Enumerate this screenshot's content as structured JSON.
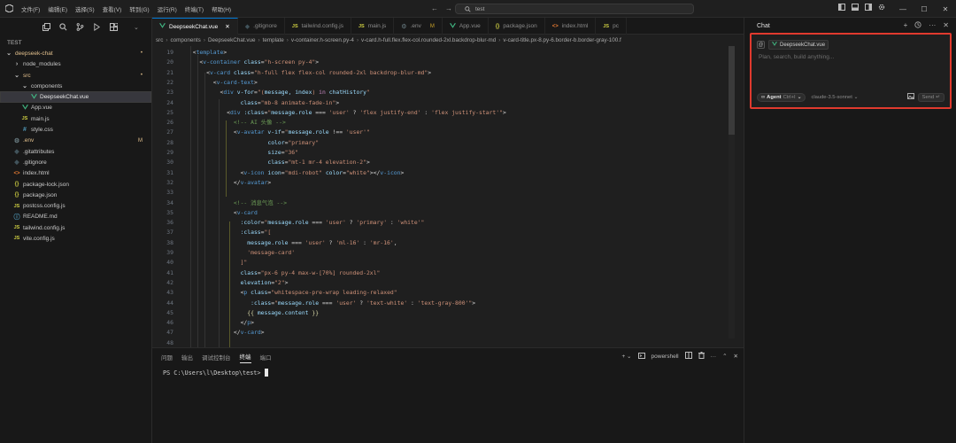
{
  "titlebar": {
    "menu": [
      "文件(F)",
      "编辑(E)",
      "选择(S)",
      "查看(V)",
      "转到(G)",
      "运行(R)",
      "终端(T)",
      "帮助(H)"
    ],
    "search_text": "test"
  },
  "sidebar": {
    "root": "TEST",
    "items": [
      {
        "label": "deepseek-chat",
        "badge": "•",
        "icon": "chevron-down",
        "indent": 0,
        "color": "#e2c08d"
      },
      {
        "label": "node_modules",
        "badge": "",
        "icon": "chevron-right",
        "indent": 1,
        "color": "#c8c8c8"
      },
      {
        "label": "src",
        "badge": "•",
        "icon": "chevron-down",
        "indent": 1,
        "color": "#e2c08d"
      },
      {
        "label": "components",
        "badge": "",
        "icon": "chevron-down",
        "indent": 2,
        "color": "#c8c8c8"
      },
      {
        "label": "DeepseekChat.vue",
        "badge": "",
        "icon": "vue",
        "indent": 3,
        "color": "#e7e7e7",
        "active": true
      },
      {
        "label": "App.vue",
        "badge": "",
        "icon": "vue",
        "indent": 2,
        "color": "#c8c8c8"
      },
      {
        "label": "main.js",
        "badge": "",
        "icon": "js",
        "indent": 2,
        "color": "#c8c8c8"
      },
      {
        "label": "style.css",
        "badge": "",
        "icon": "css",
        "indent": 2,
        "color": "#c8c8c8"
      },
      {
        "label": ".env",
        "badge": "M",
        "icon": "gear",
        "indent": 1,
        "color": "#e2c08d"
      },
      {
        "label": ".gitattributes",
        "badge": "",
        "icon": "git",
        "indent": 1,
        "color": "#c8c8c8"
      },
      {
        "label": ".gitignore",
        "badge": "",
        "icon": "git",
        "indent": 1,
        "color": "#c8c8c8"
      },
      {
        "label": "index.html",
        "badge": "",
        "icon": "html",
        "indent": 1,
        "color": "#c8c8c8"
      },
      {
        "label": "package-lock.json",
        "badge": "",
        "icon": "json",
        "indent": 1,
        "color": "#c8c8c8"
      },
      {
        "label": "package.json",
        "badge": "",
        "icon": "json",
        "indent": 1,
        "color": "#c8c8c8"
      },
      {
        "label": "postcss.config.js",
        "badge": "",
        "icon": "js",
        "indent": 1,
        "color": "#c8c8c8"
      },
      {
        "label": "README.md",
        "badge": "",
        "icon": "info",
        "indent": 1,
        "color": "#c8c8c8"
      },
      {
        "label": "tailwind.config.js",
        "badge": "",
        "icon": "js",
        "indent": 1,
        "color": "#c8c8c8"
      },
      {
        "label": "vite.config.js",
        "badge": "",
        "icon": "js",
        "indent": 1,
        "color": "#c8c8c8"
      }
    ]
  },
  "tabs": [
    {
      "label": "DeepseekChat.vue",
      "icon": "vue",
      "active": true,
      "modified": ""
    },
    {
      "label": ".gitignore",
      "icon": "git",
      "active": false,
      "modified": ""
    },
    {
      "label": "tailwind.config.js",
      "icon": "js",
      "active": false,
      "modified": ""
    },
    {
      "label": "main.js",
      "icon": "js",
      "active": false,
      "modified": ""
    },
    {
      "label": ".env",
      "icon": "gear",
      "active": false,
      "modified": "M"
    },
    {
      "label": "App.vue",
      "icon": "vue",
      "active": false,
      "modified": ""
    },
    {
      "label": "package.json",
      "icon": "json",
      "active": false,
      "modified": ""
    },
    {
      "label": "index.html",
      "icon": "html",
      "active": false,
      "modified": ""
    },
    {
      "label": "pc",
      "icon": "js",
      "active": false,
      "modified": ""
    }
  ],
  "breadcrumb": [
    "src",
    "components",
    "DeepseekChat.vue",
    "template",
    "v-container.h-screen.py-4",
    "v-card.h-full.flex.flex-col.rounded-2xl.backdrop-blur-md",
    "v-card-title.px-8.py-6.border-b.border-gray-100.f"
  ],
  "code_lines": [
    {
      "n": "19",
      "t": [
        [
          "",
          "  "
        ],
        [
          "t-br",
          "<"
        ],
        [
          "t-tag",
          "template"
        ],
        [
          "t-br",
          ">"
        ]
      ]
    },
    {
      "n": "20",
      "t": [
        [
          "",
          "    "
        ],
        [
          "t-br",
          "<"
        ],
        [
          "t-tag",
          "v-container"
        ],
        [
          "",
          " "
        ],
        [
          "t-attr",
          "class"
        ],
        [
          "",
          "="
        ],
        [
          "t-str",
          "\"h-screen py-4\""
        ],
        [
          "t-br",
          ">"
        ]
      ]
    },
    {
      "n": "21",
      "t": [
        [
          "",
          "      "
        ],
        [
          "t-br",
          "<"
        ],
        [
          "t-tag",
          "v-card"
        ],
        [
          "",
          " "
        ],
        [
          "t-attr",
          "class"
        ],
        [
          "",
          "="
        ],
        [
          "t-str",
          "\"h-full flex flex-col rounded-2xl backdrop-blur-md\""
        ],
        [
          "t-br",
          ">"
        ]
      ]
    },
    {
      "n": "22",
      "t": [
        [
          "",
          "        "
        ],
        [
          "t-br",
          "<"
        ],
        [
          "t-tag",
          "v-card-text"
        ],
        [
          "t-br",
          ">"
        ]
      ]
    },
    {
      "n": "23",
      "t": [
        [
          "",
          "          "
        ],
        [
          "t-br",
          "<"
        ],
        [
          "t-tag",
          "div"
        ],
        [
          "",
          " "
        ],
        [
          "t-attr",
          "v-for"
        ],
        [
          "",
          "="
        ],
        [
          "t-str",
          "\"("
        ],
        [
          "t-var",
          "message, index"
        ],
        [
          "t-str",
          ") "
        ],
        [
          "t-kw",
          "in"
        ],
        [
          "t-var",
          " chatHistory"
        ],
        [
          "t-str",
          "\""
        ]
      ]
    },
    {
      "n": "24",
      "t": [
        [
          "",
          "                "
        ],
        [
          "t-attr",
          "class"
        ],
        [
          "",
          "="
        ],
        [
          "t-str",
          "\"mb-8 animate-fade-in\""
        ],
        [
          "t-br",
          ">"
        ]
      ]
    },
    {
      "n": "25",
      "t": [
        [
          "",
          "            "
        ],
        [
          "t-br",
          "<"
        ],
        [
          "t-tag",
          "div"
        ],
        [
          "",
          " "
        ],
        [
          "t-attr",
          ":class"
        ],
        [
          "",
          "="
        ],
        [
          "t-str",
          "\""
        ],
        [
          "t-var",
          "message.role"
        ],
        [
          "",
          " === "
        ],
        [
          "t-str",
          "'user'"
        ],
        [
          "",
          " ? "
        ],
        [
          "t-str",
          "'flex justify-end'"
        ],
        [
          "",
          " : "
        ],
        [
          "t-str",
          "'flex justify-start'"
        ],
        [
          "t-str",
          "\""
        ],
        [
          "t-br",
          ">"
        ]
      ]
    },
    {
      "n": "26",
      "t": [
        [
          "",
          "              "
        ],
        [
          "t-com",
          "<!-- AI 头像 -->"
        ]
      ]
    },
    {
      "n": "27",
      "t": [
        [
          "",
          "              "
        ],
        [
          "t-br",
          "<"
        ],
        [
          "t-tag",
          "v-avatar"
        ],
        [
          "",
          " "
        ],
        [
          "t-attr",
          "v-if"
        ],
        [
          "",
          "="
        ],
        [
          "t-str",
          "\""
        ],
        [
          "t-var",
          "message.role"
        ],
        [
          "",
          " !== "
        ],
        [
          "t-str",
          "'user'\""
        ]
      ]
    },
    {
      "n": "28",
      "t": [
        [
          "",
          "                        "
        ],
        [
          "t-attr",
          "color"
        ],
        [
          "",
          "="
        ],
        [
          "t-str",
          "\"primary\""
        ]
      ]
    },
    {
      "n": "29",
      "t": [
        [
          "",
          "                        "
        ],
        [
          "t-attr",
          "size"
        ],
        [
          "",
          "="
        ],
        [
          "t-str",
          "\"36\""
        ]
      ]
    },
    {
      "n": "30",
      "t": [
        [
          "",
          "                        "
        ],
        [
          "t-attr",
          "class"
        ],
        [
          "",
          "="
        ],
        [
          "t-str",
          "\"mt-1 mr-4 elevation-2\""
        ],
        [
          "t-br",
          ">"
        ]
      ]
    },
    {
      "n": "31",
      "t": [
        [
          "",
          "                "
        ],
        [
          "t-br",
          "<"
        ],
        [
          "t-tag",
          "v-icon"
        ],
        [
          "",
          " "
        ],
        [
          "t-attr",
          "icon"
        ],
        [
          "",
          "="
        ],
        [
          "t-str",
          "\"mdi-robot\""
        ],
        [
          "",
          " "
        ],
        [
          "t-attr",
          "color"
        ],
        [
          "",
          "="
        ],
        [
          "t-str",
          "\"white\""
        ],
        [
          "t-br",
          "></"
        ],
        [
          "t-tag",
          "v-icon"
        ],
        [
          "t-br",
          ">"
        ]
      ]
    },
    {
      "n": "32",
      "t": [
        [
          "",
          "              "
        ],
        [
          "t-br",
          "</"
        ],
        [
          "t-tag",
          "v-avatar"
        ],
        [
          "t-br",
          ">"
        ]
      ]
    },
    {
      "n": "33",
      "t": [
        [
          "",
          ""
        ]
      ]
    },
    {
      "n": "34",
      "t": [
        [
          "",
          "              "
        ],
        [
          "t-com",
          "<!-- 消息气泡 -->"
        ]
      ]
    },
    {
      "n": "35",
      "t": [
        [
          "",
          "              "
        ],
        [
          "t-br",
          "<"
        ],
        [
          "t-tag",
          "v-card"
        ]
      ]
    },
    {
      "n": "36",
      "t": [
        [
          "",
          "                "
        ],
        [
          "t-attr",
          ":color"
        ],
        [
          "",
          "="
        ],
        [
          "t-str",
          "\""
        ],
        [
          "t-var",
          "message.role"
        ],
        [
          "",
          " === "
        ],
        [
          "t-str",
          "'user'"
        ],
        [
          "",
          " ? "
        ],
        [
          "t-str",
          "'primary'"
        ],
        [
          "",
          " : "
        ],
        [
          "t-str",
          "'white'\""
        ]
      ]
    },
    {
      "n": "37",
      "t": [
        [
          "",
          "                "
        ],
        [
          "t-attr",
          ":class"
        ],
        [
          "",
          "="
        ],
        [
          "t-str",
          "\"["
        ]
      ]
    },
    {
      "n": "38",
      "t": [
        [
          "",
          "                  "
        ],
        [
          "t-var",
          "message.role"
        ],
        [
          "",
          " === "
        ],
        [
          "t-str",
          "'user'"
        ],
        [
          "",
          " ? "
        ],
        [
          "t-str",
          "'ml-16'"
        ],
        [
          "",
          " : "
        ],
        [
          "t-str",
          "'mr-16'"
        ],
        [
          "",
          ","
        ]
      ]
    },
    {
      "n": "39",
      "t": [
        [
          "",
          "                  "
        ],
        [
          "t-str",
          "'message-card'"
        ]
      ]
    },
    {
      "n": "40",
      "t": [
        [
          "",
          "                "
        ],
        [
          "t-str",
          "]\""
        ]
      ]
    },
    {
      "n": "41",
      "t": [
        [
          "",
          "                "
        ],
        [
          "t-attr",
          "class"
        ],
        [
          "",
          "="
        ],
        [
          "t-str",
          "\"px-6 py-4 max-w-[70%] rounded-2xl\""
        ]
      ]
    },
    {
      "n": "42",
      "t": [
        [
          "",
          "                "
        ],
        [
          "t-attr",
          "elevation"
        ],
        [
          "",
          "="
        ],
        [
          "t-str",
          "\"2\""
        ],
        [
          "t-br",
          ">"
        ]
      ]
    },
    {
      "n": "43",
      "t": [
        [
          "",
          "                "
        ],
        [
          "t-br",
          "<"
        ],
        [
          "t-tag",
          "p"
        ],
        [
          "",
          " "
        ],
        [
          "t-attr",
          "class"
        ],
        [
          "",
          "="
        ],
        [
          "t-str",
          "\"whitespace-pre-wrap leading-relaxed\""
        ]
      ]
    },
    {
      "n": "44",
      "t": [
        [
          "",
          "                   "
        ],
        [
          "t-attr",
          ":class"
        ],
        [
          "",
          "="
        ],
        [
          "t-str",
          "\""
        ],
        [
          "t-var",
          "message.role"
        ],
        [
          "",
          " === "
        ],
        [
          "t-str",
          "'user'"
        ],
        [
          "",
          " ? "
        ],
        [
          "t-str",
          "'text-white'"
        ],
        [
          "",
          " : "
        ],
        [
          "t-str",
          "'text-gray-800'\""
        ],
        [
          "t-br",
          ">"
        ]
      ]
    },
    {
      "n": "45",
      "t": [
        [
          "",
          "                  "
        ],
        [
          "t-y",
          "{{ "
        ],
        [
          "t-var",
          "message.content"
        ],
        [
          "t-y",
          " }}"
        ]
      ]
    },
    {
      "n": "46",
      "t": [
        [
          "",
          "                "
        ],
        [
          "t-br",
          "</"
        ],
        [
          "t-tag",
          "p"
        ],
        [
          "t-br",
          ">"
        ]
      ]
    },
    {
      "n": "47",
      "t": [
        [
          "",
          "              "
        ],
        [
          "t-br",
          "</"
        ],
        [
          "t-tag",
          "v-card"
        ],
        [
          "t-br",
          ">"
        ]
      ]
    },
    {
      "n": "48",
      "t": [
        [
          "",
          ""
        ]
      ]
    },
    {
      "n": "49",
      "t": [
        [
          "",
          "              "
        ],
        [
          "t-com",
          "<!-- 用户头像 -->"
        ]
      ]
    },
    {
      "n": "50",
      "t": [
        [
          "",
          "              "
        ],
        [
          "t-br",
          "<"
        ],
        [
          "t-tag",
          "v-avatar"
        ],
        [
          "",
          " "
        ],
        [
          "t-attr",
          "v-if"
        ],
        [
          "",
          "="
        ],
        [
          "t-str",
          "\""
        ],
        [
          "t-var",
          "message.role"
        ],
        [
          "",
          " === "
        ],
        [
          "t-str",
          "'user'\""
        ]
      ]
    }
  ],
  "panel": {
    "tabs": [
      "问题",
      "输出",
      "调试控制台",
      "终端",
      "端口"
    ],
    "active_tab": "终端",
    "shell": "powershell",
    "prompt": "PS C:\\Users\\l\\Desktop\\test>"
  },
  "chat": {
    "title": "Chat",
    "context_file": "DeepseekChat.vue",
    "placeholder": "Plan, search, build anything...",
    "mode": "Agent",
    "mode_shortcut": "Ctrl+I",
    "model": "claude-3.5-sonnet",
    "send_label": "Send",
    "highlight_color": "#e03a2e"
  }
}
